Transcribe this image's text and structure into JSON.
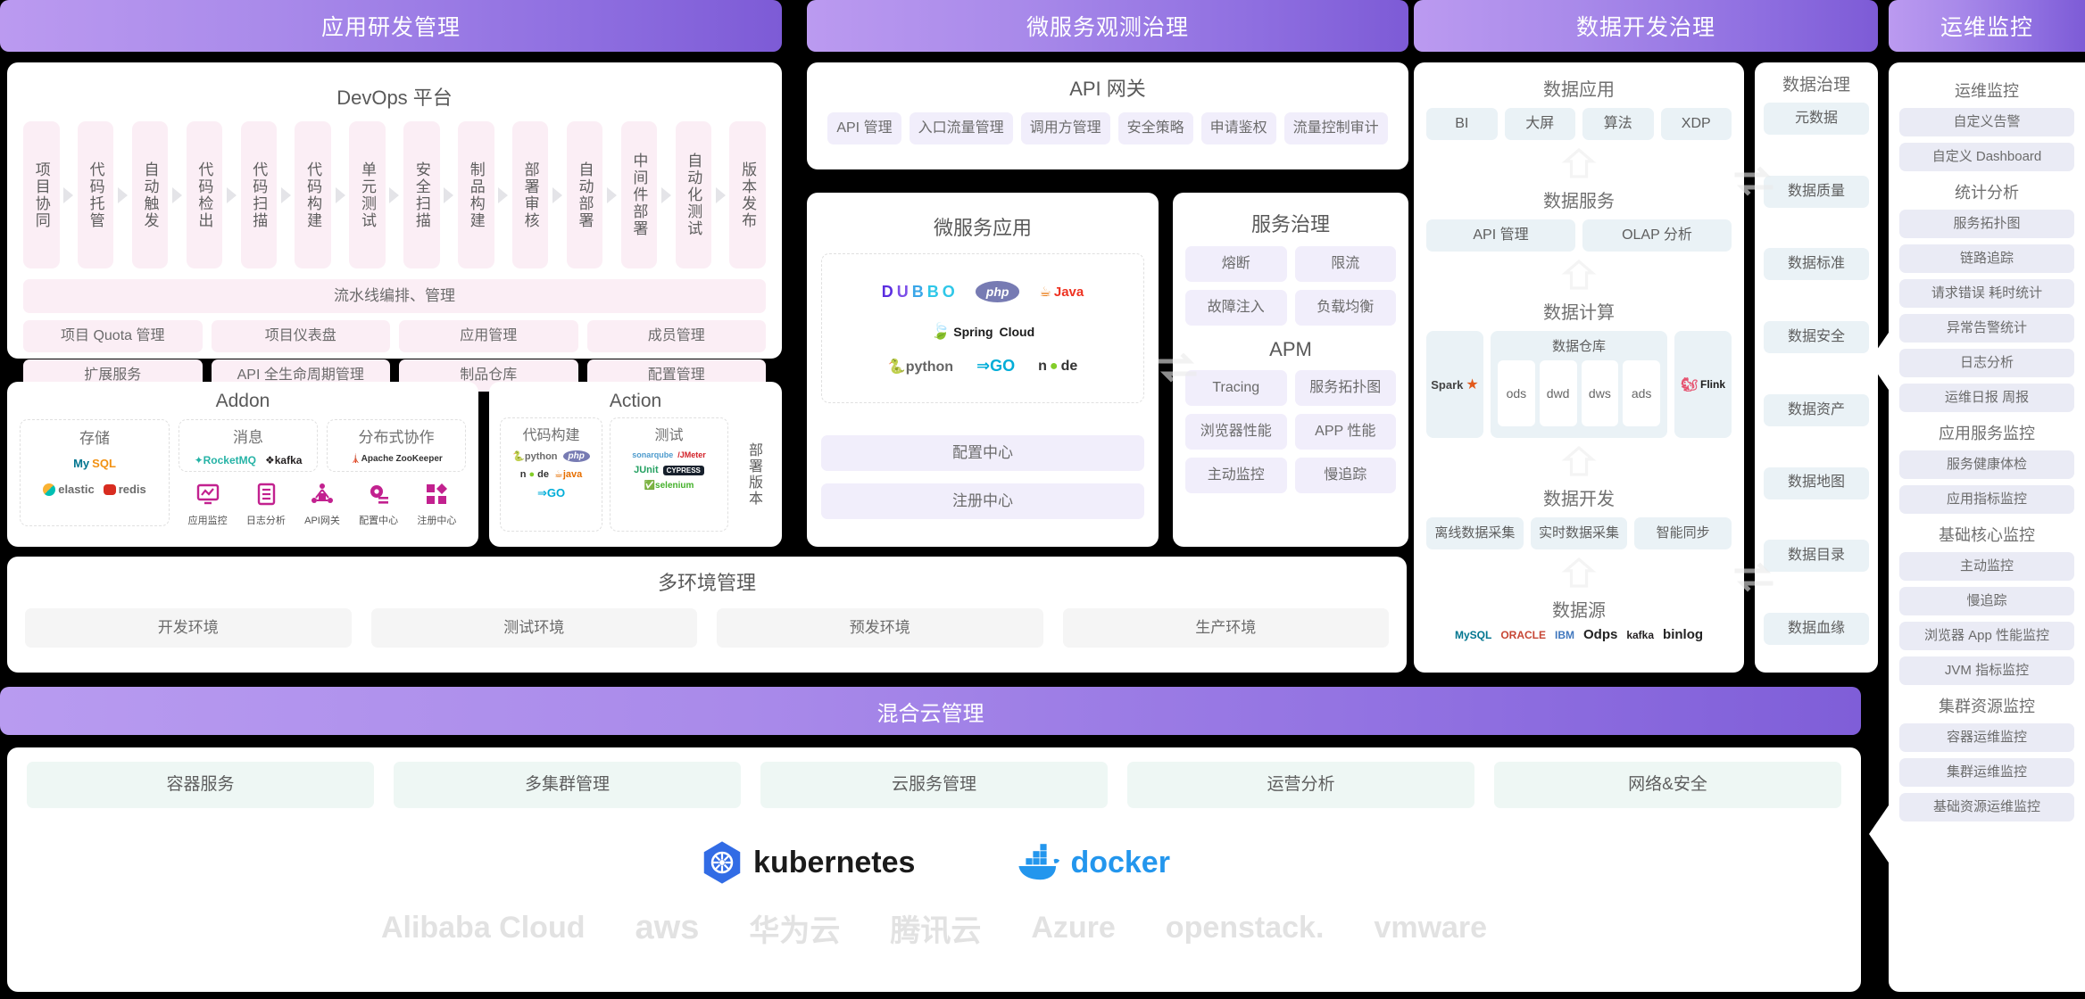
{
  "banners": [
    {
      "id": "app-dev",
      "label": "应用研发管理"
    },
    {
      "id": "microservice",
      "label": "微服务观测治理"
    },
    {
      "id": "data-dev",
      "label": "数据开发治理"
    },
    {
      "id": "ops-monitor",
      "label": "运维监控"
    }
  ],
  "devops": {
    "title": "DevOps 平台",
    "stages": [
      "项目协同",
      "代码托管",
      "自动触发",
      "代码检出",
      "代码扫描",
      "代码构建",
      "单元测试",
      "安全扫描",
      "制品构建",
      "部署审核",
      "自动部署",
      "中间件部署",
      "自动化测试",
      "版本发布"
    ],
    "pipeline_bar": "流水线编排、管理",
    "features_row1": [
      "项目 Quota 管理",
      "项目仪表盘",
      "应用管理",
      "成员管理"
    ],
    "features_row2": [
      "扩展服务",
      "API 全生命周期管理",
      "制品仓库",
      "配置管理"
    ]
  },
  "addon": {
    "title": "Addon",
    "groups": [
      {
        "name": "存储",
        "logos": [
          "MySQL",
          "elastic",
          "redis"
        ]
      },
      {
        "name": "消息",
        "logos": [
          "RocketMQ",
          "kafka"
        ]
      },
      {
        "name": "分布式协作",
        "logos": [
          "Apache ZooKeeper"
        ]
      }
    ],
    "icon_items": [
      {
        "label": "应用监控",
        "icon": "monitor-icon"
      },
      {
        "label": "日志分析",
        "icon": "log-icon"
      },
      {
        "label": "API网关",
        "icon": "gateway-icon"
      },
      {
        "label": "配置中心",
        "icon": "config-icon"
      },
      {
        "label": "注册中心",
        "icon": "registry-icon"
      }
    ]
  },
  "action": {
    "title": "Action",
    "groups": [
      {
        "name": "代码构建",
        "logos": [
          "python",
          "php",
          "node",
          "java",
          "GO"
        ]
      },
      {
        "name": "测试",
        "logos": [
          "sonarqube",
          "JMeter",
          "JUnit",
          "CYPRESS",
          "selenium"
        ]
      }
    ],
    "side_label": "部署版本"
  },
  "multi_env": {
    "title": "多环境管理",
    "items": [
      "开发环境",
      "测试环境",
      "预发环境",
      "生产环境"
    ]
  },
  "hybrid_cloud": {
    "title": "混合云管理",
    "items": [
      "容器服务",
      "多集群管理",
      "云服务管理",
      "运营分析",
      "网络&安全"
    ],
    "platform_logos": [
      "kubernetes",
      "docker"
    ],
    "vendor_logos": [
      "Alibaba Cloud",
      "aws",
      "华为云",
      "腾讯云",
      "Azure",
      "openstack.",
      "vmware"
    ]
  },
  "api_gateway": {
    "title": "API 网关",
    "items": [
      "API 管理",
      "入口流量管理",
      "调用方管理",
      "安全策略",
      "申请鉴权",
      "流量控制审计"
    ]
  },
  "micro_app": {
    "title": "微服务应用",
    "logos": [
      "DUBBO",
      "php",
      "Java",
      "Spring Cloud",
      "python",
      "GO",
      "node"
    ],
    "buttons": [
      "配置中心",
      "注册中心"
    ]
  },
  "service_gov": {
    "title": "服务治理",
    "items": [
      "熔断",
      "限流",
      "故障注入",
      "负载均衡"
    ],
    "apm_title": "APM",
    "apm_items": [
      "Tracing",
      "服务拓扑图",
      "浏览器性能",
      "APP 性能",
      "主动监控",
      "慢追踪"
    ]
  },
  "data_dev": {
    "app_title": "数据应用",
    "app_items": [
      "BI",
      "大屏",
      "算法",
      "XDP"
    ],
    "service_title": "数据服务",
    "service_items": [
      "API 管理",
      "OLAP 分析"
    ],
    "compute_title": "数据计算",
    "compute_left_logo": "Spark",
    "compute_right_logo": "Flink",
    "warehouse_title": "数据仓库",
    "warehouse_layers": [
      "ods",
      "dwd",
      "dws",
      "ads"
    ],
    "dev_title": "数据开发",
    "dev_items": [
      "离线数据采集",
      "实时数据采集",
      "智能同步"
    ],
    "source_title": "数据源",
    "source_logos": [
      "MySQL",
      "ORACLE",
      "IBM",
      "Odps",
      "kafka",
      "binlog"
    ]
  },
  "data_gov": {
    "title": "数据治理",
    "items": [
      "元数据",
      "数据质量",
      "数据标准",
      "数据安全",
      "数据资产",
      "数据地图",
      "数据目录",
      "数据血缘"
    ]
  },
  "ops": {
    "sections": [
      {
        "title": "运维监控",
        "items": [
          "自定义告警",
          "自定义 Dashboard"
        ]
      },
      {
        "title": "统计分析",
        "items": [
          "服务拓扑图",
          "链路追踪",
          "请求错误 耗时统计",
          "异常告警统计",
          "日志分析",
          "运维日报 周报"
        ]
      },
      {
        "title": "应用服务监控",
        "items": [
          "服务健康体检",
          "应用指标监控"
        ]
      },
      {
        "title": "基础核心监控",
        "items": [
          "主动监控",
          "慢追踪",
          "浏览器 App 性能监控",
          "JVM 指标监控"
        ]
      },
      {
        "title": "集群资源监控",
        "items": [
          "容器运维监控",
          "集群运维监控",
          "基础资源运维监控"
        ]
      }
    ]
  },
  "colors": {
    "banner_start": "#bb9af0",
    "banner_end": "#7d5bd6",
    "pill_pink": "#fbeef5",
    "pill_lilac": "#f1eefb",
    "pill_blue": "#eaf2f6",
    "pill_mint": "#eef7f4",
    "pill_lav": "#eaebf5"
  }
}
